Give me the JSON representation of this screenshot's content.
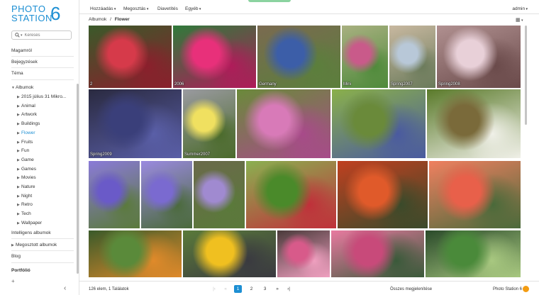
{
  "logo": {
    "line1": "PHOTO",
    "line2": "STATION",
    "version": "6"
  },
  "search": {
    "placeholder": "Keresés"
  },
  "sidebar": {
    "items": [
      "Magamról",
      "Bejegyzések",
      "Téma"
    ],
    "albums_label": "Albumok",
    "albums": [
      "2015 július 31 Mikro...",
      "Animal",
      "Artwork",
      "Buildings",
      "Flower",
      "Fruits",
      "Fun",
      "Game",
      "Games",
      "Movies",
      "Nature",
      "Night",
      "Retro",
      "Tech",
      "Wallpaper"
    ],
    "active_album": "Flower",
    "smart_albums": "Intelligens albumok",
    "shared_albums": "Megosztott albumok",
    "blog": "Blog",
    "portfolio": "Portfólió"
  },
  "topbar": {
    "menus": [
      "Hozzáadás",
      "Megosztás",
      "Diavetítés",
      "Egyéb"
    ],
    "user": "admin"
  },
  "breadcrumb": {
    "root": "Albumok",
    "separator": "/",
    "current": "Flower"
  },
  "photos": [
    {
      "caption": "2",
      "colors": [
        "#d63a4a",
        "#8b1f2c",
        "#3a5a2a"
      ]
    },
    {
      "caption": "2006",
      "colors": [
        "#e8307a",
        "#b01b5a",
        "#2f7a3a"
      ]
    },
    {
      "caption": "Germany",
      "colors": [
        "#3c5ea8",
        "#5b7f3c",
        "#7a6a50"
      ]
    },
    {
      "caption": "Mini",
      "colors": [
        "#c95a8a",
        "#4e8a3a",
        "#a8b080"
      ]
    },
    {
      "caption": "Spring2007",
      "colors": [
        "#b8c8d8",
        "#6a7a5a",
        "#c8b8a0"
      ]
    },
    {
      "caption": "Spring2008",
      "colors": [
        "#e8d0d8",
        "#6a4a4a",
        "#b09090"
      ]
    },
    {
      "caption": "Spring2009",
      "colors": [
        "#3a3f7a",
        "#5a5fa8",
        "#2a2a40"
      ]
    },
    {
      "caption": "Summer2007",
      "colors": [
        "#f0e060",
        "#4a6a2a",
        "#9a9aa0"
      ]
    },
    {
      "caption": "",
      "colors": [
        "#d87ab8",
        "#a84a8a",
        "#6a8a3a"
      ]
    },
    {
      "caption": "",
      "colors": [
        "#6a8a3a",
        "#4a5aa0",
        "#8ab04a"
      ]
    },
    {
      "caption": "",
      "colors": [
        "#7a6a3a",
        "#f0f0e8",
        "#5a7a2a"
      ]
    },
    {
      "caption": "",
      "colors": [
        "#6a5ac8",
        "#5a7a3a",
        "#8a7ad8"
      ]
    },
    {
      "caption": "",
      "colors": [
        "#7a6ad0",
        "#4a6a3a",
        "#9a8ae0"
      ]
    },
    {
      "caption": "",
      "colors": [
        "#a08ad0",
        "#5a7a3a",
        "#6a6a4a"
      ]
    },
    {
      "caption": "",
      "colors": [
        "#4a8a2a",
        "#c0303a",
        "#8ab050"
      ]
    },
    {
      "caption": "",
      "colors": [
        "#e05a2a",
        "#3a4a2a",
        "#c04020"
      ]
    },
    {
      "caption": "",
      "colors": [
        "#e8604a",
        "#4a6a3a",
        "#f08060"
      ]
    },
    {
      "caption": "",
      "colors": [
        "#5a8a3a",
        "#e08a2a",
        "#3a5a2a"
      ]
    },
    {
      "caption": "",
      "colors": [
        "#f0c020",
        "#3a3a40",
        "#5a7a3a"
      ]
    },
    {
      "caption": "",
      "colors": [
        "#d85a8a",
        "#f0a0c0",
        "#4a3a3a"
      ]
    },
    {
      "caption": "",
      "colors": [
        "#c84a7a",
        "#3a5a3a",
        "#e87aa0"
      ]
    },
    {
      "caption": "",
      "colors": [
        "#4a8a3a",
        "#a8c880",
        "#2a4a2a"
      ]
    }
  ],
  "footer": {
    "count": "126 elem, 1 Találatok",
    "pages": [
      "1",
      "2",
      "3"
    ],
    "current_page": "1",
    "show_all": "Összes megjelenítése",
    "brand": "Photo Station 6"
  }
}
